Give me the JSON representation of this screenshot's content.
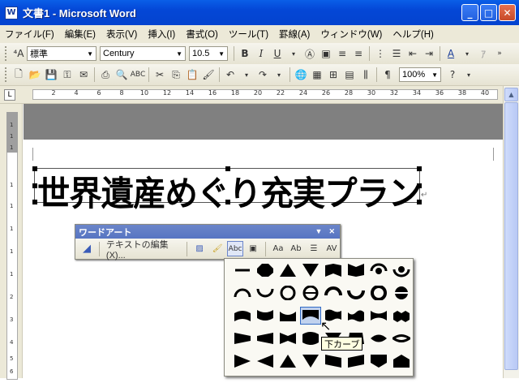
{
  "window": {
    "title": "文書1 - Microsoft Word",
    "icon_glyph": "W",
    "buttons": {
      "minimize": "_",
      "maximize": "□",
      "close": "✕"
    }
  },
  "menu": [
    "ファイル(F)",
    "編集(E)",
    "表示(V)",
    "挿入(I)",
    "書式(O)",
    "ツール(T)",
    "罫線(A)",
    "ウィンドウ(W)",
    "ヘルプ(H)"
  ],
  "format_toolbar": {
    "style": "標準",
    "font": "Century",
    "size": "10.5",
    "bold": "B",
    "italic": "I",
    "underline": "U"
  },
  "standard_toolbar": {
    "zoom": "100%"
  },
  "ruler": {
    "corner": "L",
    "ticks": [
      "2",
      "4",
      "6",
      "8",
      "10",
      "12",
      "14",
      "16",
      "18",
      "20",
      "22",
      "24",
      "26",
      "28",
      "30",
      "32",
      "34",
      "36",
      "38",
      "40"
    ]
  },
  "vruler": {
    "ticks": [
      "1",
      "1",
      "1",
      "1",
      "1",
      "1",
      "1",
      "1",
      "2",
      "3",
      "4",
      "5",
      "6"
    ]
  },
  "document": {
    "wordart_text": "世界遺産めぐり充実プラン",
    "para_mark": "↵"
  },
  "wordart_toolbar": {
    "title": "ワードアート",
    "edit_text": "テキストの編集(X)...",
    "close": "✕",
    "menu": "▼"
  },
  "shape_palette": {
    "selected_index": 19,
    "tooltip": "下カーブ"
  },
  "colors": {
    "titlebar": "#0447d6",
    "selected": "#c1d2ee"
  }
}
